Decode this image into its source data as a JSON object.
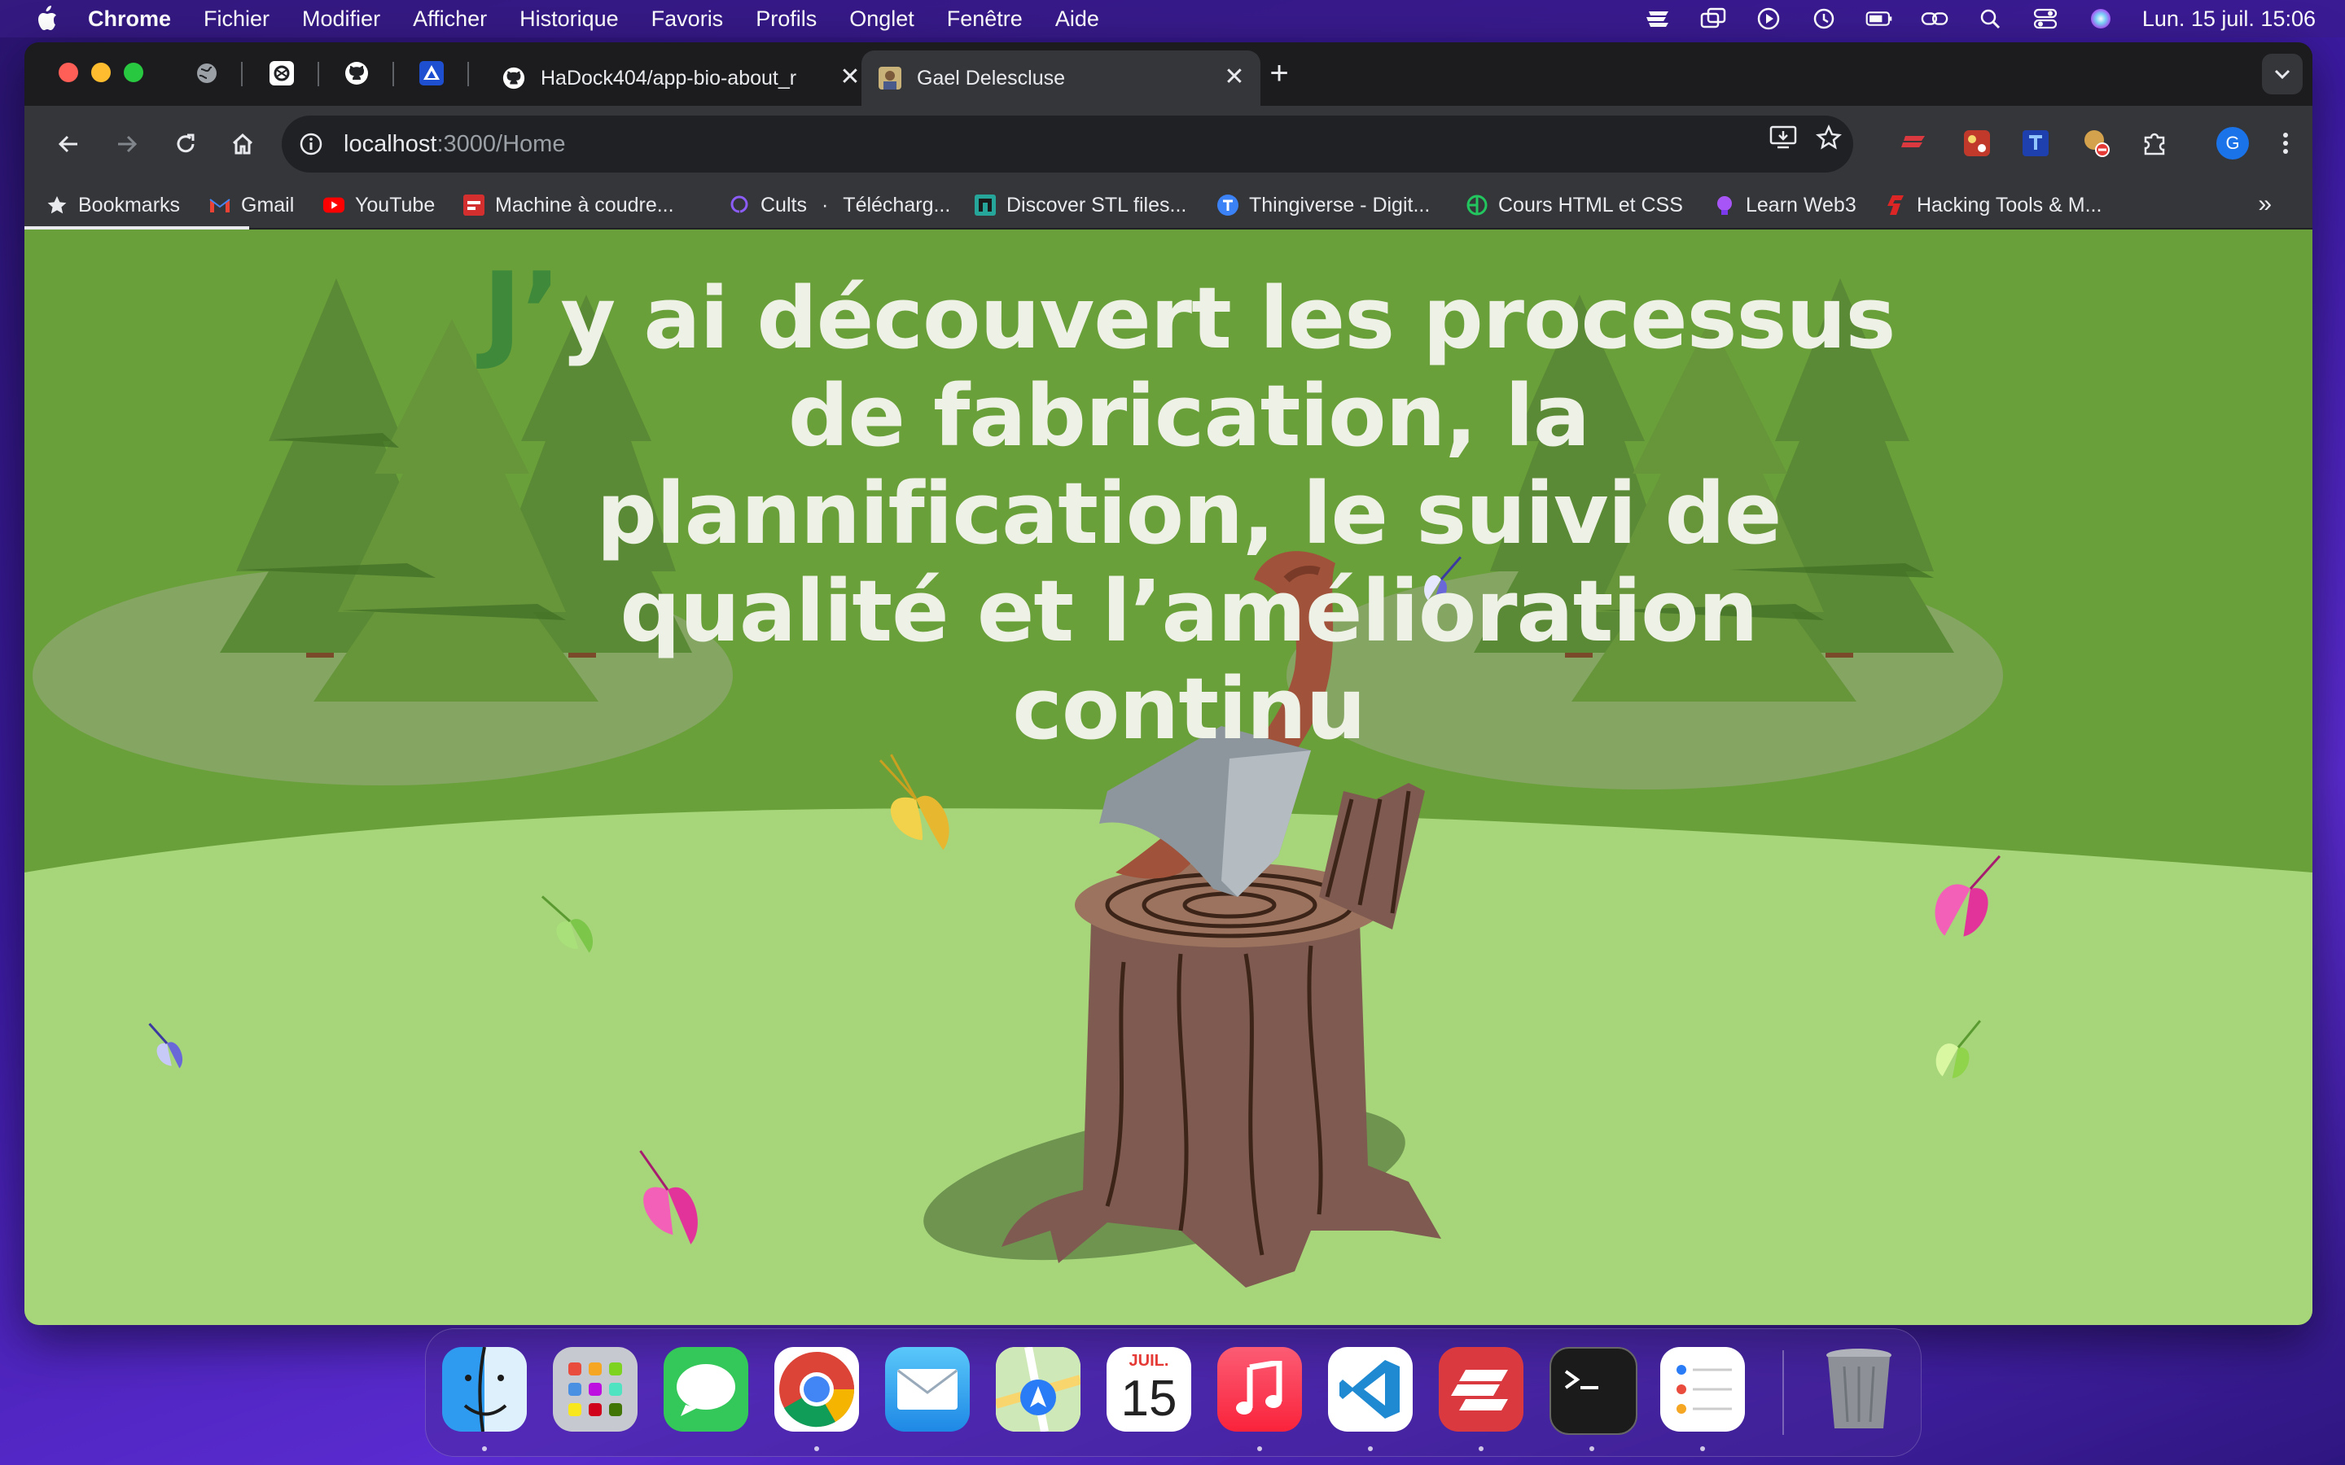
{
  "menubar": {
    "app_name": "Chrome",
    "menus": [
      "Fichier",
      "Modifier",
      "Afficher",
      "Historique",
      "Favoris",
      "Profils",
      "Onglet",
      "Fenêtre",
      "Aide"
    ],
    "clock": "Lun. 15 juil.  15:06"
  },
  "tabs": {
    "github_tab_title": "HaDock404/app-bio-about_r",
    "active_tab_title": "Gael Delescluse",
    "close_glyph": "✕",
    "new_tab_glyph": "+"
  },
  "address_bar": {
    "host": "localhost",
    "path": ":3000/Home"
  },
  "profile_initial": "G",
  "bookmarks": [
    {
      "label": "Bookmarks",
      "icon": "star-icon"
    },
    {
      "label": "Gmail",
      "icon": "gmail-icon"
    },
    {
      "label": "YouTube",
      "icon": "youtube-icon"
    },
    {
      "label": "Machine à coudre...",
      "icon": "sewing-icon"
    },
    {
      "label": "Cults",
      "icon": "cults-icon"
    },
    {
      "label": "Télécharg...",
      "icon": ""
    },
    {
      "label": "Discover STL files...",
      "icon": "stl-icon"
    },
    {
      "label": "Thingiverse - Digit...",
      "icon": "thingiverse-icon"
    },
    {
      "label": "Cours HTML et CSS",
      "icon": "course-icon"
    },
    {
      "label": "Learn Web3",
      "icon": "web3-icon"
    },
    {
      "label": "Hacking Tools & M...",
      "icon": "hacking-icon"
    }
  ],
  "bookmark_separator": "·",
  "page": {
    "headline_dropcap": "J’",
    "headline_rest": "y ai découvert les processus de fabrication, la plannification, le suivi de qualité et l’amélioration continu"
  },
  "dock": {
    "calendar_month": "JUIL.",
    "calendar_day": "15"
  },
  "colors": {
    "page_background": "#6aa03a",
    "ground": "#a6d57a",
    "headline": "#eef2e6"
  }
}
